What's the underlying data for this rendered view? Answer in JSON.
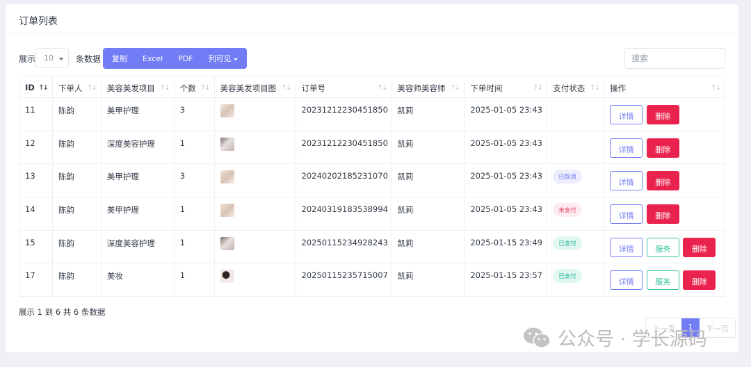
{
  "card": {
    "title": "订单列表"
  },
  "toolbar": {
    "show_label": "展示",
    "page_size": "10",
    "rows_label": "条数据",
    "buttons": [
      "复制",
      "Excel",
      "PDF",
      "列可见"
    ],
    "search_placeholder": "搜索"
  },
  "table": {
    "headers": [
      "ID",
      "下单人",
      "美容美发项目",
      "个数",
      "美容美发项目图",
      "订单号",
      "美容师美容师",
      "下单时间",
      "支付状态",
      "操作"
    ],
    "rows": [
      {
        "id": "11",
        "customer": "陈韵",
        "project": "美甲护理",
        "count": "3",
        "order_no": "20231212230451850",
        "stylist": "凯莉",
        "time": "2025-01-05 23:43",
        "status": ""
      },
      {
        "id": "12",
        "customer": "陈韵",
        "project": "深度美容护理",
        "count": "1",
        "order_no": "20231212230451850",
        "stylist": "凯莉",
        "time": "2025-01-05 23:43",
        "status": ""
      },
      {
        "id": "13",
        "customer": "陈韵",
        "project": "美甲护理",
        "count": "3",
        "order_no": "20240202185231070",
        "stylist": "凯莉",
        "time": "2025-01-05 23:43",
        "status": "已取消"
      },
      {
        "id": "14",
        "customer": "陈韵",
        "project": "美甲护理",
        "count": "1",
        "order_no": "20240319183538994",
        "stylist": "凯莉",
        "time": "2025-01-05 23:43",
        "status": "未支付"
      },
      {
        "id": "15",
        "customer": "陈韵",
        "project": "深度美容护理",
        "count": "1",
        "order_no": "20250115234928243",
        "stylist": "凯莉",
        "time": "2025-01-15 23:49",
        "status": "已支付"
      },
      {
        "id": "17",
        "customer": "陈韵",
        "project": "美妆",
        "count": "1",
        "order_no": "20250115235715007",
        "stylist": "凯莉",
        "time": "2025-01-15 23:57",
        "status": "已支付"
      }
    ],
    "actions": {
      "detail": "详情",
      "service": "服务",
      "delete": "删除"
    }
  },
  "footer": {
    "info": "展示 1 到 6 共 6 条数据"
  },
  "pagination": {
    "prev": "上一页",
    "current": "1",
    "next": "下一页"
  },
  "watermark": {
    "text": "公众号 · 学长源码"
  },
  "colors": {
    "primary": "#727cf5",
    "danger": "#e9234d",
    "success": "#35c4a0",
    "background": "#eff0f6"
  }
}
